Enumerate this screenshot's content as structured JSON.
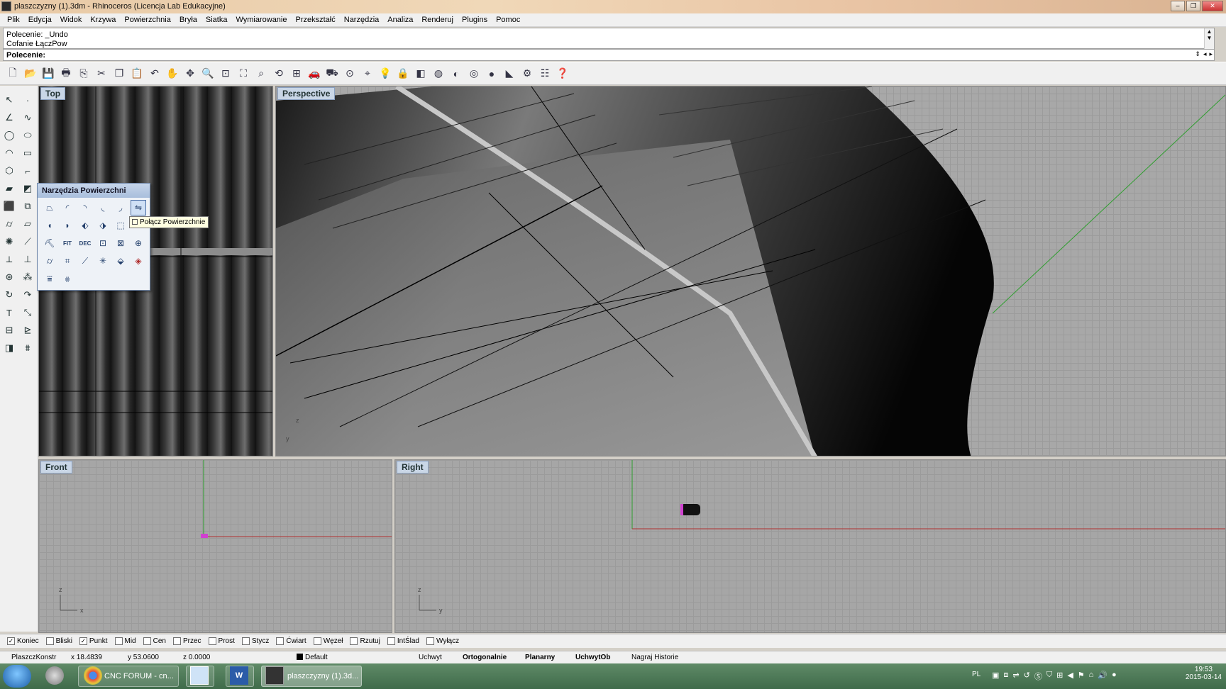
{
  "window": {
    "title": "plaszczyzny (1).3dm - Rhinoceros (Licencja Lab Edukacyjne)",
    "minimize_glyph": "–",
    "maximize_glyph": "❐",
    "close_glyph": "✕"
  },
  "menu": [
    "Plik",
    "Edycja",
    "Widok",
    "Krzywa",
    "Powierzchnia",
    "Bryła",
    "Siatka",
    "Wymiarowanie",
    "Przekształć",
    "Narzędzia",
    "Analiza",
    "Renderuj",
    "Plugins",
    "Pomoc"
  ],
  "command": {
    "history": [
      "Polecenie: _Undo",
      "Cofanie ŁączPow"
    ],
    "prompt_label": "Polecenie:",
    "input_value": ""
  },
  "viewports": {
    "top": "Top",
    "perspective": "Perspective",
    "front": "Front",
    "right": "Right"
  },
  "flyout": {
    "title": "Narzędzia Powierzchni",
    "row3_labels": [
      "FIT",
      "DEC"
    ],
    "tooltip": "Połącz Powierzchnie"
  },
  "osnaps": [
    {
      "label": "Koniec",
      "checked": true
    },
    {
      "label": "Bliski",
      "checked": false
    },
    {
      "label": "Punkt",
      "checked": true
    },
    {
      "label": "Mid",
      "checked": false
    },
    {
      "label": "Cen",
      "checked": false
    },
    {
      "label": "Przec",
      "checked": false
    },
    {
      "label": "Prost",
      "checked": false
    },
    {
      "label": "Stycz",
      "checked": false
    },
    {
      "label": "Ćwiart",
      "checked": false
    },
    {
      "label": "Węzeł",
      "checked": false
    },
    {
      "label": "Rzutuj",
      "checked": false
    },
    {
      "label": "IntŚlad",
      "checked": false
    },
    {
      "label": "Wyłącz",
      "checked": false
    }
  ],
  "status": {
    "cplane": "PlaszczKonstr",
    "x": "x 18.4839",
    "y": "y 53.0600",
    "z": "z 0.0000",
    "layer": "Default",
    "uchwyt": "Uchwyt",
    "ortho": "Ortogonalnie",
    "planar": "Planarny",
    "osnap": "UchwytOb",
    "history": "Nagraj Historie"
  },
  "taskbar": {
    "items": [
      "CNC FORUM - cn...",
      "",
      "",
      "plaszczyzny (1).3d..."
    ],
    "lang": "PL",
    "time": "19:53",
    "date": "2015-03-14"
  },
  "colors": {
    "accent": "#4b6fa5",
    "x_axis": "#b03030",
    "y_axis": "#2f9e2f"
  }
}
